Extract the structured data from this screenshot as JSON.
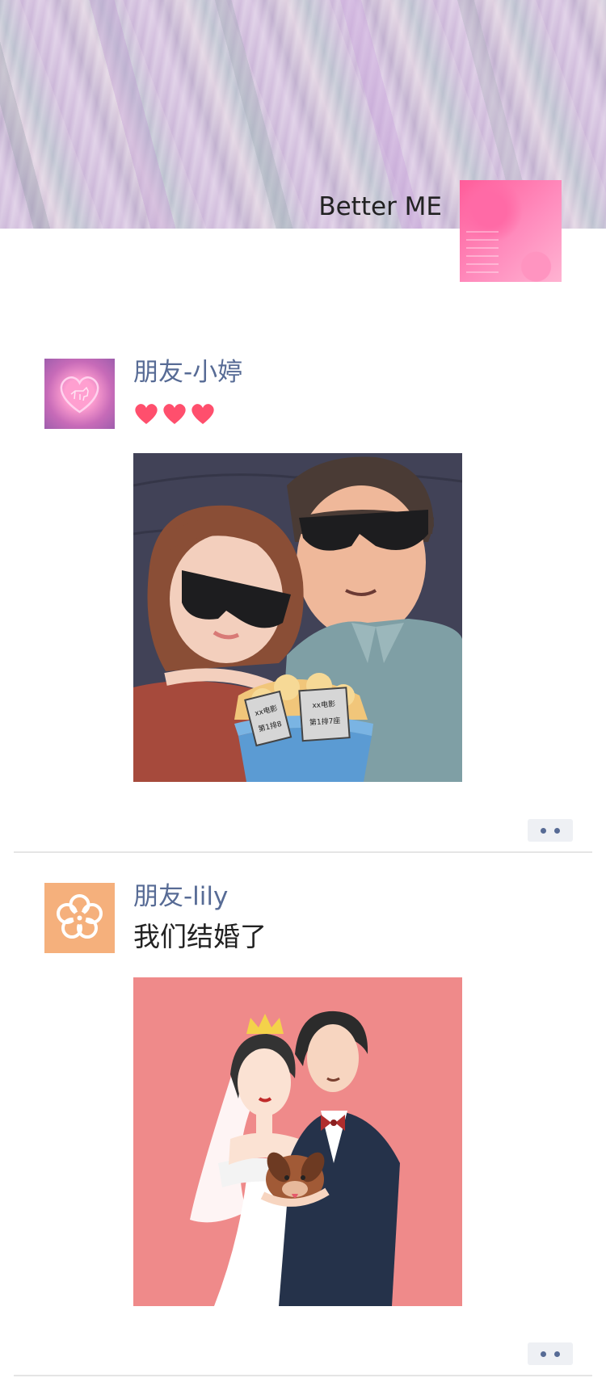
{
  "profile": {
    "name": "Better ME",
    "cover_colors": [
      "#cbb6d8",
      "#bcc1cf",
      "#dfd0e0"
    ],
    "avatar_color": "#ff6aa6"
  },
  "posts": [
    {
      "username": "朋友-小婷",
      "avatar_icon": "neon-heart-dog-icon",
      "content_icon": "three-hearts",
      "hearts_count": 3,
      "image": {
        "description_icon": "couple-at-movies-illustration",
        "ticket_left_line1": "xx电影",
        "ticket_left_line2": "第1排8",
        "ticket_right_line1": "xx电影",
        "ticket_right_line2": "第1排7座"
      }
    },
    {
      "username": "朋友-lily",
      "avatar_icon": "flower-icon",
      "text": "我们结婚了",
      "image": {
        "description_icon": "wedding-couple-illustration"
      }
    }
  ],
  "colors": {
    "link_name": "#576b95",
    "heart": "#ff4f6d",
    "divider": "#e5e5e5",
    "wedding_bg": "#ef8a8a",
    "cinema_bg": "#414257"
  }
}
